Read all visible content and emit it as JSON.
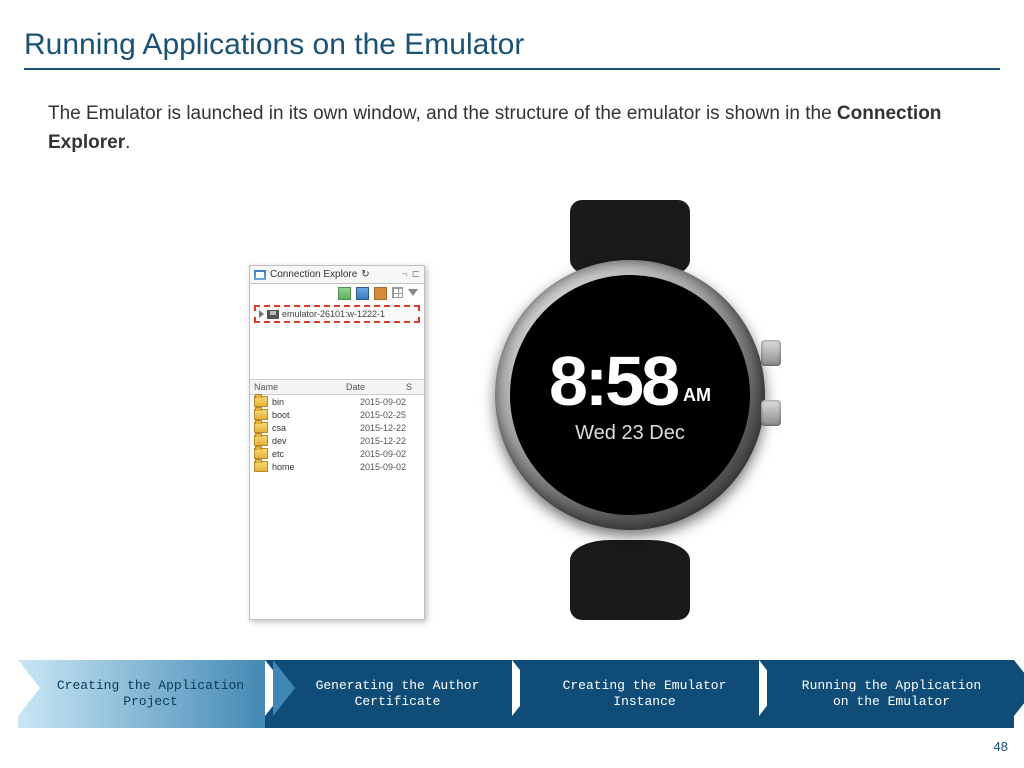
{
  "title": "Running Applications on the Emulator",
  "intro": {
    "part1": "The Emulator is launched in its own window, and the structure of the emulator is shown in the ",
    "bold": "Connection Explorer",
    "part2": "."
  },
  "explorer": {
    "tab_label": "Connection Explore",
    "tab_refresh_glyph": "↻",
    "tab_min1": "¬",
    "tab_min2": "⊏",
    "highlighted_device": "emulator-26101:w-1222-1",
    "columns": {
      "name": "Name",
      "date": "Date",
      "size": "S"
    },
    "files": [
      {
        "name": "bin",
        "date": "2015-09-02"
      },
      {
        "name": "boot",
        "date": "2015-02-25"
      },
      {
        "name": "csa",
        "date": "2015-12-22"
      },
      {
        "name": "dev",
        "date": "2015-12-22"
      },
      {
        "name": "etc",
        "date": "2015-09-02"
      },
      {
        "name": "home",
        "date": "2015-09-02"
      }
    ]
  },
  "watch": {
    "time": "8:58",
    "ampm": "AM",
    "date": "Wed 23 Dec"
  },
  "steps": [
    "Creating the Application Project",
    "Generating the Author Certificate",
    "Creating the Emulator Instance",
    "Running the Application on the Emulator"
  ],
  "page_number": "48"
}
